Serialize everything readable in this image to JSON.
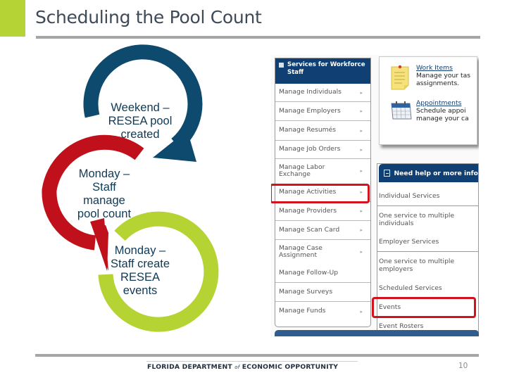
{
  "slide": {
    "title": "Scheduling the Pool Count",
    "page_number": "10",
    "footer_org_part1": "FLORIDA DEPARTMENT ",
    "footer_org_of": "of",
    "footer_org_part2": " ECONOMIC OPPORTUNITY",
    "colors": {
      "accent_green": "#b5d334",
      "cycle_blue": "#0e4a6e",
      "cycle_red": "#c0101b",
      "cycle_green": "#b6d334",
      "highlight_red": "#d3121e",
      "menu_navy": "#0f3f73"
    }
  },
  "cycle": {
    "steps": [
      {
        "label_lines": [
          "Weekend –",
          "RESEA pool",
          "created"
        ]
      },
      {
        "label_lines": [
          "Monday –",
          "Staff",
          "manage",
          "pool count"
        ]
      },
      {
        "label_lines": [
          "Monday –",
          "Staff create",
          "RESEA",
          "events"
        ]
      }
    ]
  },
  "screenshot": {
    "staff_menu": {
      "header": "Services for Workforce Staff",
      "items": [
        {
          "label": "Manage Individuals",
          "has_submenu": true
        },
        {
          "label": "Manage Employers",
          "has_submenu": true
        },
        {
          "label": "Manage Resumés",
          "has_submenu": true
        },
        {
          "label": "Manage Job Orders",
          "has_submenu": true
        },
        {
          "label": "Manage Labor Exchange",
          "has_submenu": true
        },
        {
          "label": "Manage Activities",
          "has_submenu": true,
          "highlighted": true
        },
        {
          "label": "Manage Providers",
          "has_submenu": true
        },
        {
          "label": "Manage Scan Card",
          "has_submenu": true
        },
        {
          "label": "Manage Case Assignment",
          "has_submenu": true
        },
        {
          "label": "Manage Follow-Up",
          "has_submenu": false
        },
        {
          "label": "Manage Surveys",
          "has_submenu": false
        },
        {
          "label": "Manage Funds",
          "has_submenu": true
        }
      ]
    },
    "quick_links": [
      {
        "icon": "sticky-note-icon",
        "title": "Work Items",
        "desc_lines": [
          "Manage your tas",
          "assignments."
        ]
      },
      {
        "icon": "calendar-icon",
        "title": "Appointments",
        "desc_lines": [
          "Schedule appoi",
          "manage your ca"
        ]
      }
    ],
    "help_panel": {
      "header": "Need help or more info",
      "items": [
        {
          "label": "Individual Services"
        },
        {
          "label": "One service to multiple individuals"
        },
        {
          "label": "Employer Services"
        },
        {
          "label": "One service to multiple employers"
        },
        {
          "label": "Scheduled Services"
        },
        {
          "label": "Events",
          "highlighted": true
        },
        {
          "label": "Event Rosters"
        }
      ]
    }
  }
}
